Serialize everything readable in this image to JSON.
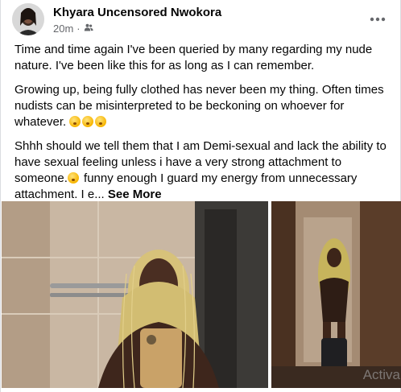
{
  "post": {
    "author": "Khyara Uncensored Nwokora",
    "time": "20m",
    "dot": "·",
    "privacy_icon": "friends-icon",
    "more_icon": "more-horizontal-icon",
    "paragraphs": [
      "Time and time again I've been queried  by many regarding my nude nature. I've been like this for as long as I  can remember.",
      "Growing up, being fully clothed has never been my thing. Often times nudists can be misinterpreted to be beckoning on whoever for whatever."
    ],
    "paragraph3": "Shhh should we tell them that I am Demi-sexual and lack the ability to have sexual feeling unless i have a very strong attachment to someone.",
    "paragraph3_cont": " funny enough I guard my energy from unnecessary attachment. I e...",
    "see_more": "See More"
  },
  "watermark": "Activa"
}
